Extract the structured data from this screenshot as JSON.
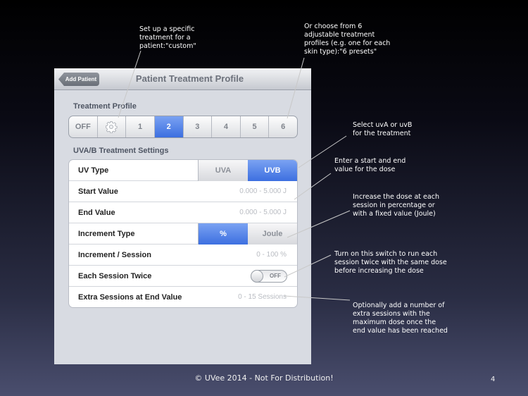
{
  "navbar": {
    "back_label": "Add Patient",
    "title": "Patient Treatment Profile"
  },
  "treatment_profile": {
    "section_label": "Treatment Profile",
    "segments": [
      "OFF",
      "",
      "1",
      "2",
      "3",
      "4",
      "5",
      "6"
    ],
    "selected": "2",
    "gear_icon": "gear-icon"
  },
  "uv_settings": {
    "section_label": "UVA/B Treatment Settings",
    "rows": {
      "uv_type": {
        "label": "UV Type",
        "options": [
          "UVA",
          "UVB"
        ],
        "selected": "UVB"
      },
      "start_value": {
        "label": "Start Value",
        "value": "0.000 - 5.000 J"
      },
      "end_value": {
        "label": "End Value",
        "value": "0.000 - 5.000 J"
      },
      "increment_type": {
        "label": "Increment Type",
        "options": [
          "%",
          "Joule"
        ],
        "selected": "%"
      },
      "increment_session": {
        "label": "Increment / Session",
        "value": "0 - 100 %"
      },
      "each_session_twice": {
        "label": "Each Session Twice",
        "toggle_text": "OFF"
      },
      "extra_sessions": {
        "label": "Extra Sessions at End Value",
        "value": "0 - 15 Sessions"
      }
    }
  },
  "callouts": {
    "custom": [
      "Set up a specific",
      "treatment for a",
      "patient:\"custom\""
    ],
    "presets": [
      "Or choose from 6",
      "adjustable treatment",
      "profiles (e.g. one for each",
      "skin type):\"6 presets\""
    ],
    "uv_type": [
      "Select uvA or uvB",
      "for the treatment"
    ],
    "dose": [
      "Enter a start and end",
      "value for the dose"
    ],
    "increment": [
      "Increase the dose at each",
      "session in percentage or",
      "with a fixed value (Joule)"
    ],
    "twice": [
      "Turn on this switch to run each",
      "session twice with the same dose",
      "before increasing the dose"
    ],
    "extra": [
      "Optionally add a number of",
      "extra sessions with the",
      "maximum dose once the",
      "end value has been reached"
    ]
  },
  "footer": {
    "copyright": "© UVee 2014 - Not For Distribution!",
    "page_number": "4"
  },
  "colors": {
    "accent_blue": "#3d6fe0",
    "background_top": "#000000",
    "background_bottom": "#4a4e6e"
  }
}
